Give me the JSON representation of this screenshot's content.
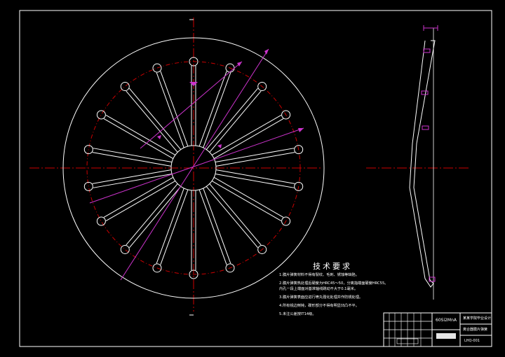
{
  "sheet": {
    "background": "#000000",
    "line_white": "#ffffff",
    "center_red": "#cc0000",
    "dim_magenta": "#cc33cc",
    "slot_count": 18
  },
  "notes": {
    "title": "技术要求",
    "items": [
      "1.膜片弹簧材料不得有裂纹、毛刺、锈蚀等缺陷。",
      "2.膜片弹簧热处理后硬度为HRC45～50，分离指端面硬度HRC55。",
      "  内孔一段上端面对基准轴线跳动不大于0.1毫米。",
      "3.膜片弹簧表面应进行喷丸强化处理并作防锈处理。",
      "4.所有锐边倒钝，碟形部分不得有明显凹凸不平。",
      "5.未注公差按IT14级。"
    ]
  },
  "title_block": {
    "material": "60Si2MnA",
    "school": "某某学院毕业设计",
    "drawing_name": "离合器膜片弹簧",
    "drawing_no": "LHQ-001"
  }
}
